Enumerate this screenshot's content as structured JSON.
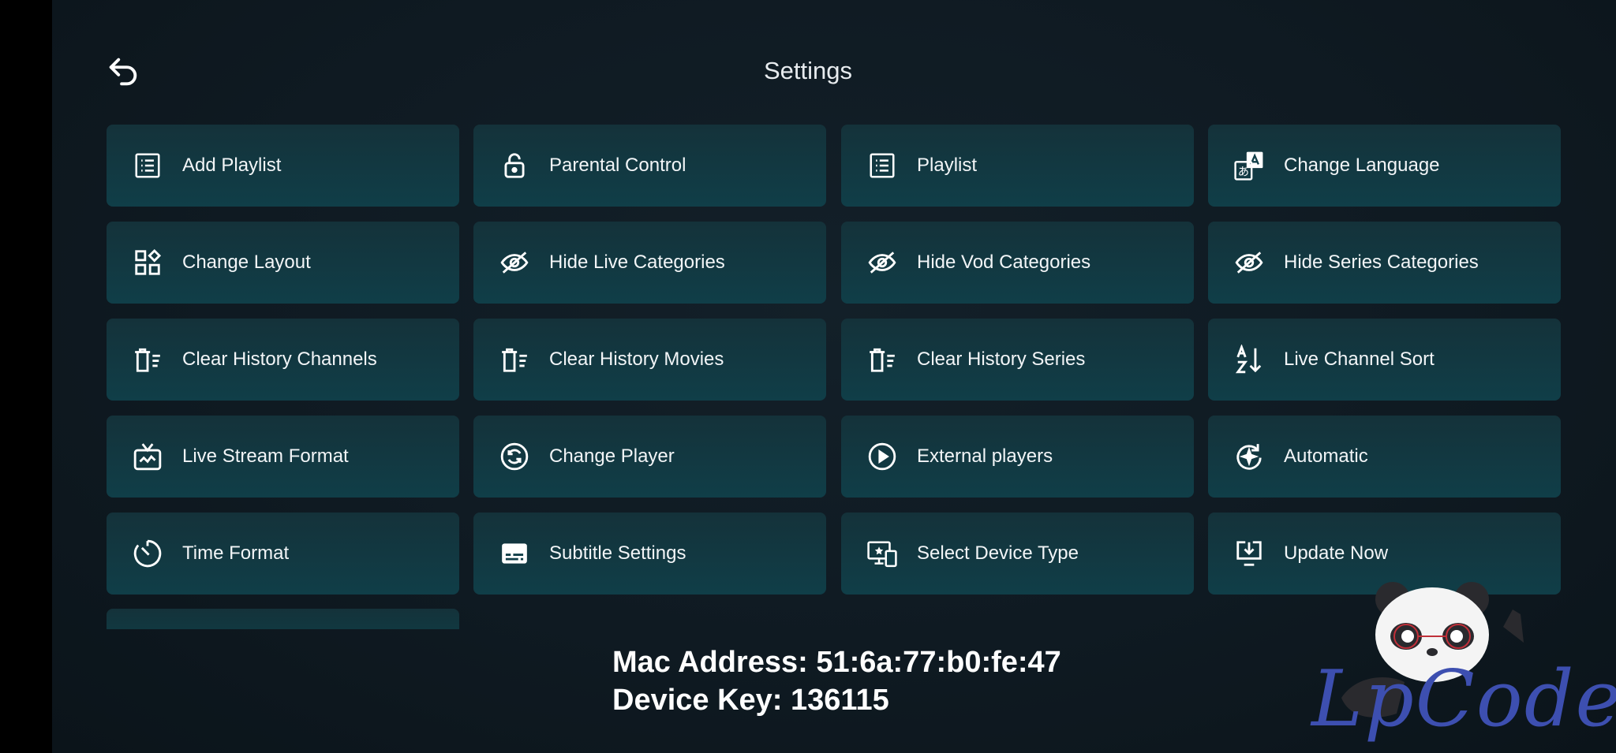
{
  "header": {
    "title": "Settings",
    "back_icon": "back-arrow-icon"
  },
  "grid": [
    {
      "label": "Add Playlist",
      "icon": "list-icon"
    },
    {
      "label": "Parental Control",
      "icon": "lock-icon"
    },
    {
      "label": "Playlist",
      "icon": "list-icon"
    },
    {
      "label": "Change Language",
      "icon": "translate-icon"
    },
    {
      "label": "Change Layout",
      "icon": "layout-icon"
    },
    {
      "label": "Hide Live Categories",
      "icon": "eye-off-icon"
    },
    {
      "label": "Hide Vod Categories",
      "icon": "eye-off-icon"
    },
    {
      "label": "Hide Series Categories",
      "icon": "eye-off-icon"
    },
    {
      "label": "Clear History Channels",
      "icon": "clear-history-icon"
    },
    {
      "label": "Clear History Movies",
      "icon": "clear-history-icon"
    },
    {
      "label": "Clear History Series",
      "icon": "clear-history-icon"
    },
    {
      "label": "Live Channel Sort",
      "icon": "sort-az-icon"
    },
    {
      "label": "Live Stream Format",
      "icon": "tv-icon"
    },
    {
      "label": "Change Player",
      "icon": "sync-icon"
    },
    {
      "label": "External players",
      "icon": "play-circle-icon"
    },
    {
      "label": "Automatic",
      "icon": "auto-icon"
    },
    {
      "label": "Time Format",
      "icon": "timer-icon"
    },
    {
      "label": "Subtitle Settings",
      "icon": "subtitles-icon"
    },
    {
      "label": "Select Device Type",
      "icon": "devices-icon"
    },
    {
      "label": "Update Now",
      "icon": "download-icon"
    }
  ],
  "device": {
    "mac_line": "Mac Address: 51:6a:77:b0:fe:47",
    "key_line": "Device Key: 136115"
  },
  "watermark": {
    "text": "LpCodes",
    "icon": "panda-mascot-icon"
  }
}
